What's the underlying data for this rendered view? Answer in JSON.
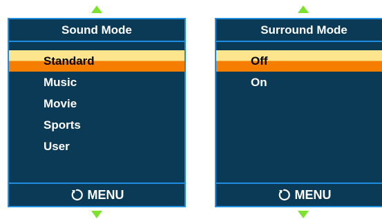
{
  "colors": {
    "panel_bg": "#0b3a56",
    "border": "#1e8fe0",
    "highlight_top": "#fde58d",
    "highlight_bottom": "#f57d00",
    "nav_arrow": "#7ce22c"
  },
  "sound_mode": {
    "title": "Sound Mode",
    "items": [
      {
        "label": "Standard",
        "selected": true
      },
      {
        "label": "Music",
        "selected": false
      },
      {
        "label": "Movie",
        "selected": false
      },
      {
        "label": "Sports",
        "selected": false
      },
      {
        "label": "User",
        "selected": false
      }
    ],
    "footer_label": "MENU",
    "footer_icon": "return-icon"
  },
  "surround_mode": {
    "title": "Surround Mode",
    "items": [
      {
        "label": "Off",
        "selected": true
      },
      {
        "label": "On",
        "selected": false
      }
    ],
    "footer_label": "MENU",
    "footer_icon": "return-icon"
  },
  "nav_icons": [
    "arrow-up-icon",
    "arrow-down-icon"
  ]
}
